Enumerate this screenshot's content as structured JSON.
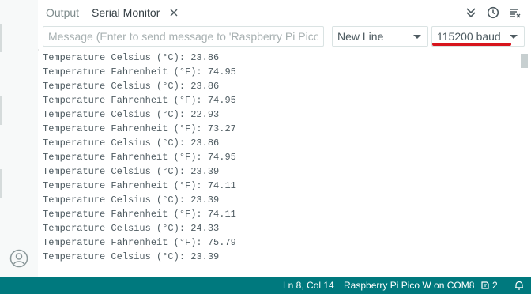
{
  "tabs": {
    "output_label": "Output",
    "serial_label": "Serial Monitor"
  },
  "input": {
    "placeholder": "Message (Enter to send message to 'Raspberry Pi Pico W' ..."
  },
  "line_ending": {
    "selected": "New Line"
  },
  "baud": {
    "selected": "115200 baud"
  },
  "lines": [
    "Temperature Celsius (°C): 23.86",
    "Temperature Fahrenheit (°F): 74.95",
    "Temperature Celsius (°C): 23.86",
    "Temperature Fahrenheit (°F): 74.95",
    "Temperature Celsius (°C): 22.93",
    "Temperature Fahrenheit (°F): 73.27",
    "Temperature Celsius (°C): 23.86",
    "Temperature Fahrenheit (°F): 74.95",
    "Temperature Celsius (°C): 23.39",
    "Temperature Fahrenheit (°F): 74.11",
    "Temperature Celsius (°C): 23.39",
    "Temperature Fahrenheit (°F): 74.11",
    "Temperature Celsius (°C): 24.33",
    "Temperature Fahrenheit (°F): 75.79",
    "Temperature Celsius (°C): 23.39"
  ],
  "status": {
    "position": "Ln 8, Col 14",
    "board": "Raspberry Pi Pico W on COM8",
    "notifications": "2"
  },
  "colors": {
    "statusbar": "#00797e",
    "highlight": "#d7141c"
  }
}
